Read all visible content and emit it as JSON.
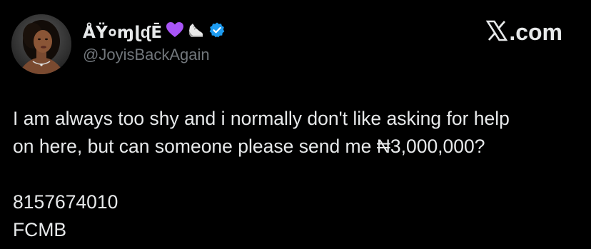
{
  "tweet": {
    "author": {
      "display_name": "ÅŸ०ɱɭᶑĒ",
      "handle": "@JoyisBackAgain",
      "avatar": "profile-photo-woman",
      "badges": [
        "purple-heart-icon",
        "sneaker-icon",
        "verified-badge-icon"
      ],
      "verified_color": "#1d9bf0",
      "heart_color": "#a855f7"
    },
    "brand": {
      "logo": "x-logo-icon",
      "text": ".com"
    },
    "body_lines": [
      "I am always too shy and i normally don't like asking for help",
      "on here, but can someone please send me ₦3,000,000?",
      "",
      "8157674010",
      "FCMB"
    ]
  },
  "colors": {
    "background": "#000000",
    "text_primary": "#e7e9ea",
    "text_secondary": "#71767b"
  }
}
